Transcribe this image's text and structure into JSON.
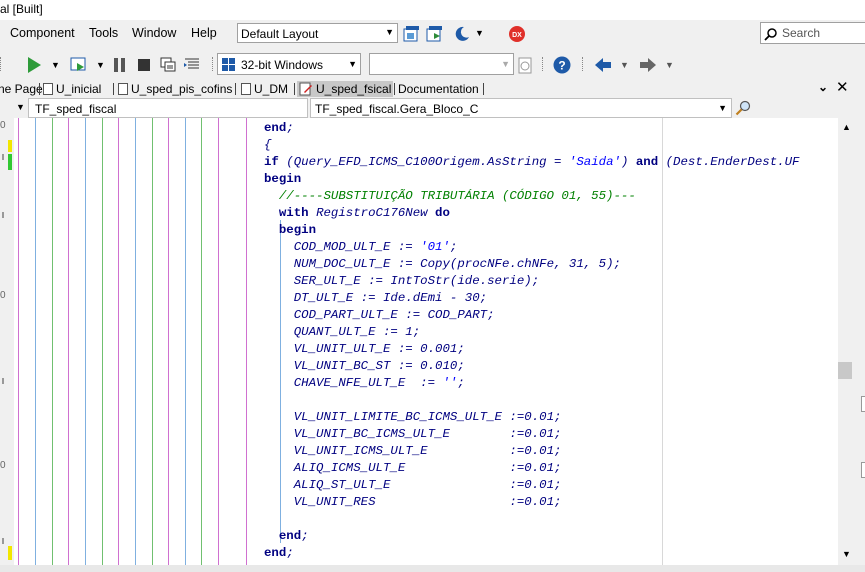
{
  "title": "al [Built]",
  "menu": {
    "items": [
      {
        "label": "Component"
      },
      {
        "label": "Tools"
      },
      {
        "label": "Window"
      },
      {
        "label": "Help"
      }
    ],
    "layout_value": "Default Layout",
    "search_placeholder": "Search",
    "dx_badge": "DX"
  },
  "toolbar": {
    "platform_value": "32-bit Windows",
    "config_value": ""
  },
  "tabs": [
    {
      "label": "ne Page",
      "active": false
    },
    {
      "label": "U_inicial",
      "active": false
    },
    {
      "label": "U_sped_pis_cofins",
      "active": false
    },
    {
      "label": "U_DM",
      "active": false
    },
    {
      "label": "U_sped_fsical",
      "active": true
    },
    {
      "label": "Documentation",
      "active": false
    }
  ],
  "navbar": {
    "class_value": "TF_sped_fiscal",
    "method_value": "TF_sped_fiscal.Gera_Bloco_C"
  },
  "code_lines": [
    "end;",
    "{",
    "if (Query_EFD_ICMS_C100Origem.AsString = 'Saida') and (Dest.EnderDest.UF",
    "begin",
    "  //----SUBSTITUIÇÃO TRIBUTÁRIA (CÓDIGO 01, 55)---",
    "  with RegistroC176New do",
    "  begin",
    "    COD_MOD_ULT_E := '01';",
    "    NUM_DOC_ULT_E := Copy(procNFe.chNFe, 31, 5);",
    "    SER_ULT_E := IntToStr(ide.serie);",
    "    DT_ULT_E := Ide.dEmi - 30;",
    "    COD_PART_ULT_E := COD_PART;",
    "    QUANT_ULT_E := 1;",
    "    VL_UNIT_ULT_E := 0.001;",
    "    VL_UNIT_BC_ST := 0.010;",
    "    CHAVE_NFE_ULT_E  := '';",
    "",
    "    VL_UNIT_LIMITE_BC_ICMS_ULT_E :=0.01;",
    "    VL_UNIT_BC_ICMS_ULT_E        :=0.01;",
    "    VL_UNIT_ICMS_ULT_E           :=0.01;",
    "    ALIQ_ICMS_ULT_E              :=0.01;",
    "    ALIQ_ST_ULT_E                :=0.01;",
    "    VL_UNIT_RES                  :=0.01;",
    "",
    "  end;",
    "end;"
  ],
  "colors": {
    "guide_purple": "#d070d0",
    "guide_blue": "#7fb0e0",
    "guide_green": "#70c070",
    "keyword": "#000080",
    "comment": "#008000",
    "string": "#0000ff",
    "active_tab": "#c8c8c8"
  },
  "icons": [
    "run-icon",
    "pause-icon",
    "stop-icon",
    "help-icon",
    "back-arrow-icon",
    "forward-arrow-icon",
    "search-icon",
    "close-icon",
    "pin-icon"
  ]
}
